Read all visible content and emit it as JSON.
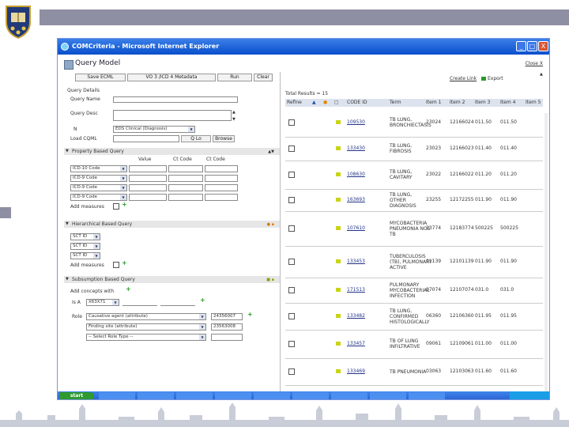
{
  "window": {
    "title": "COMCriteria - Microsoft Internet Explorer",
    "min": "_",
    "max": "□",
    "close": "X"
  },
  "app": {
    "title": "Query Model",
    "close_link": "Close X"
  },
  "toolbar": {
    "save": "Save ECML",
    "metadata": "VO 3 /ICD 4 Metadata",
    "run": "Run",
    "clear": "Clear"
  },
  "query_details": {
    "heading": "Query Details",
    "name_label": "Query Name",
    "desc_label": "Query Desc",
    "n_label": "N",
    "n_value": "EDS Clinical (Diagnosis)",
    "load_label": "Load CQML",
    "load_btn": "Q Lo",
    "browse_btn": "Browse"
  },
  "property": {
    "heading": "Property Based Query",
    "col_value": "Value",
    "col_code1": "Ct Code",
    "col_code2": "Ct Code",
    "rows": [
      "ICD-10 Code",
      "ICD-9 Code",
      "ICD-9 Code",
      "ICD-9 Code"
    ],
    "add_label": "Add measures"
  },
  "hierarchical": {
    "heading": "Hierarchical Based Query",
    "rows": [
      "SCT ID",
      "SCT ID",
      "SCT ID"
    ],
    "add_label": "Add measures"
  },
  "subsumption": {
    "heading": "Subsumption Based Query",
    "line1": "Add concepts with",
    "isa_label": "Is A",
    "isa_value": "X63X71",
    "role_label": "Role",
    "roles": [
      {
        "name": "Causative agent (attribute)",
        "code": "24356007"
      },
      {
        "name": "Finding site (attribute)",
        "code": "23563008"
      },
      {
        "name": "-- Select Role Type --",
        "code": ""
      }
    ]
  },
  "results": {
    "create_link": "Create Link",
    "export": "Export",
    "total": "Total Results = 15",
    "columns": [
      "Refine",
      "",
      "",
      "",
      "CODE ID",
      "Term",
      "Item 1",
      "Item 2",
      "Item 3",
      "Item 4",
      "Item 5"
    ],
    "rows": [
      {
        "id": "109530",
        "term": [
          "TB LUNG,",
          "BRONCHIECTASIS"
        ],
        "c1": "23024",
        "c2": "12166024",
        "c3": "011.50",
        "c4": "011.50"
      },
      {
        "id": "133430",
        "term": [
          "TB LUNG,",
          "FIBROSIS"
        ],
        "c1": "23023",
        "c2": "12166023",
        "c3": "011.40",
        "c4": "011.40"
      },
      {
        "id": "108630",
        "term": [
          "TB LUNG,",
          "CAVITARY"
        ],
        "c1": "23022",
        "c2": "12166022",
        "c3": "011.20",
        "c4": "011.20"
      },
      {
        "id": "163693",
        "term": [
          "TB LUNG,",
          "OTHER",
          "DIAGNOSIS"
        ],
        "c1": "23255",
        "c2": "12172255",
        "c3": "011.90",
        "c4": "011.90"
      },
      {
        "id": "107610",
        "term": [
          "MYCOBACTERIA",
          "PNEUMONIA NOS",
          "TB"
        ],
        "c1": "23774",
        "c2": "12183774",
        "c3": "500225",
        "c4": "500225"
      },
      {
        "id": "133453",
        "term": [
          "TUBERCULOSIS",
          "(TB), PULMONARY",
          "ACTIVE"
        ],
        "c1": "01139",
        "c2": "12101139",
        "c3": "011.90",
        "c4": "011.90"
      },
      {
        "id": "171513",
        "term": [
          "PULMONARY",
          "MYCOBACTERIAL",
          "INFECTION"
        ],
        "c1": "07074",
        "c2": "12107074",
        "c3": "031.0",
        "c4": "031.0"
      },
      {
        "id": "133482",
        "term": [
          "TB LUNG,",
          "CONFIRMED",
          "HISTOLOGICALLY"
        ],
        "c1": "06360",
        "c2": "12106360",
        "c3": "011.95",
        "c4": "011.95"
      },
      {
        "id": "133457",
        "term": [
          "TB OF LUNG",
          "INFILTRATIVE"
        ],
        "c1": "09061",
        "c2": "12109061",
        "c3": "011.00",
        "c4": "011.00"
      },
      {
        "id": "133469",
        "term": [
          "TB PNEUMONIA"
        ],
        "c1": "03063",
        "c2": "12103063",
        "c3": "011.60",
        "c4": "011.60"
      }
    ]
  },
  "taskbar": {
    "start": "start",
    "items": [
      "",
      "",
      "",
      "",
      "",
      "",
      "",
      "",
      ""
    ],
    "clock": ""
  }
}
